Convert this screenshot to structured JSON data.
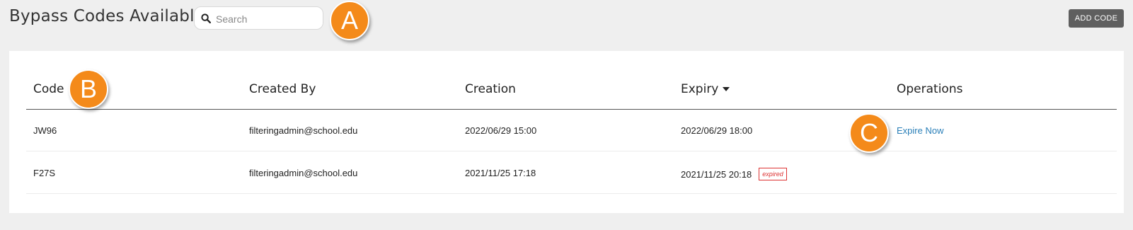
{
  "page": {
    "title": "Bypass Codes Available"
  },
  "search": {
    "placeholder": "Search",
    "value": ""
  },
  "toolbar": {
    "add_code_label": "ADD CODE"
  },
  "annotations": [
    "A",
    "B",
    "C"
  ],
  "table": {
    "columns": [
      "Code",
      "Created By",
      "Creation",
      "Expiry",
      "Operations"
    ],
    "sort_column": "Expiry",
    "sort_direction": "descending",
    "rows": [
      {
        "code": "JW96",
        "created_by": "filteringadmin@school.edu",
        "creation": "2022/06/29 15:00",
        "expiry": "2022/06/29 18:00",
        "status": "",
        "operation": "Expire Now"
      },
      {
        "code": "F27S",
        "created_by": "filteringadmin@school.edu",
        "creation": "2021/11/25 17:18",
        "expiry": "2021/11/25 20:18",
        "status": "expired",
        "operation": ""
      }
    ]
  },
  "colors": {
    "annotation": "#f48a1a",
    "link": "#2a7fb8",
    "expired": "#dd3333",
    "button": "#5f5f5f"
  },
  "icons": {
    "search": "search-icon",
    "sort": "sort-down-icon"
  }
}
